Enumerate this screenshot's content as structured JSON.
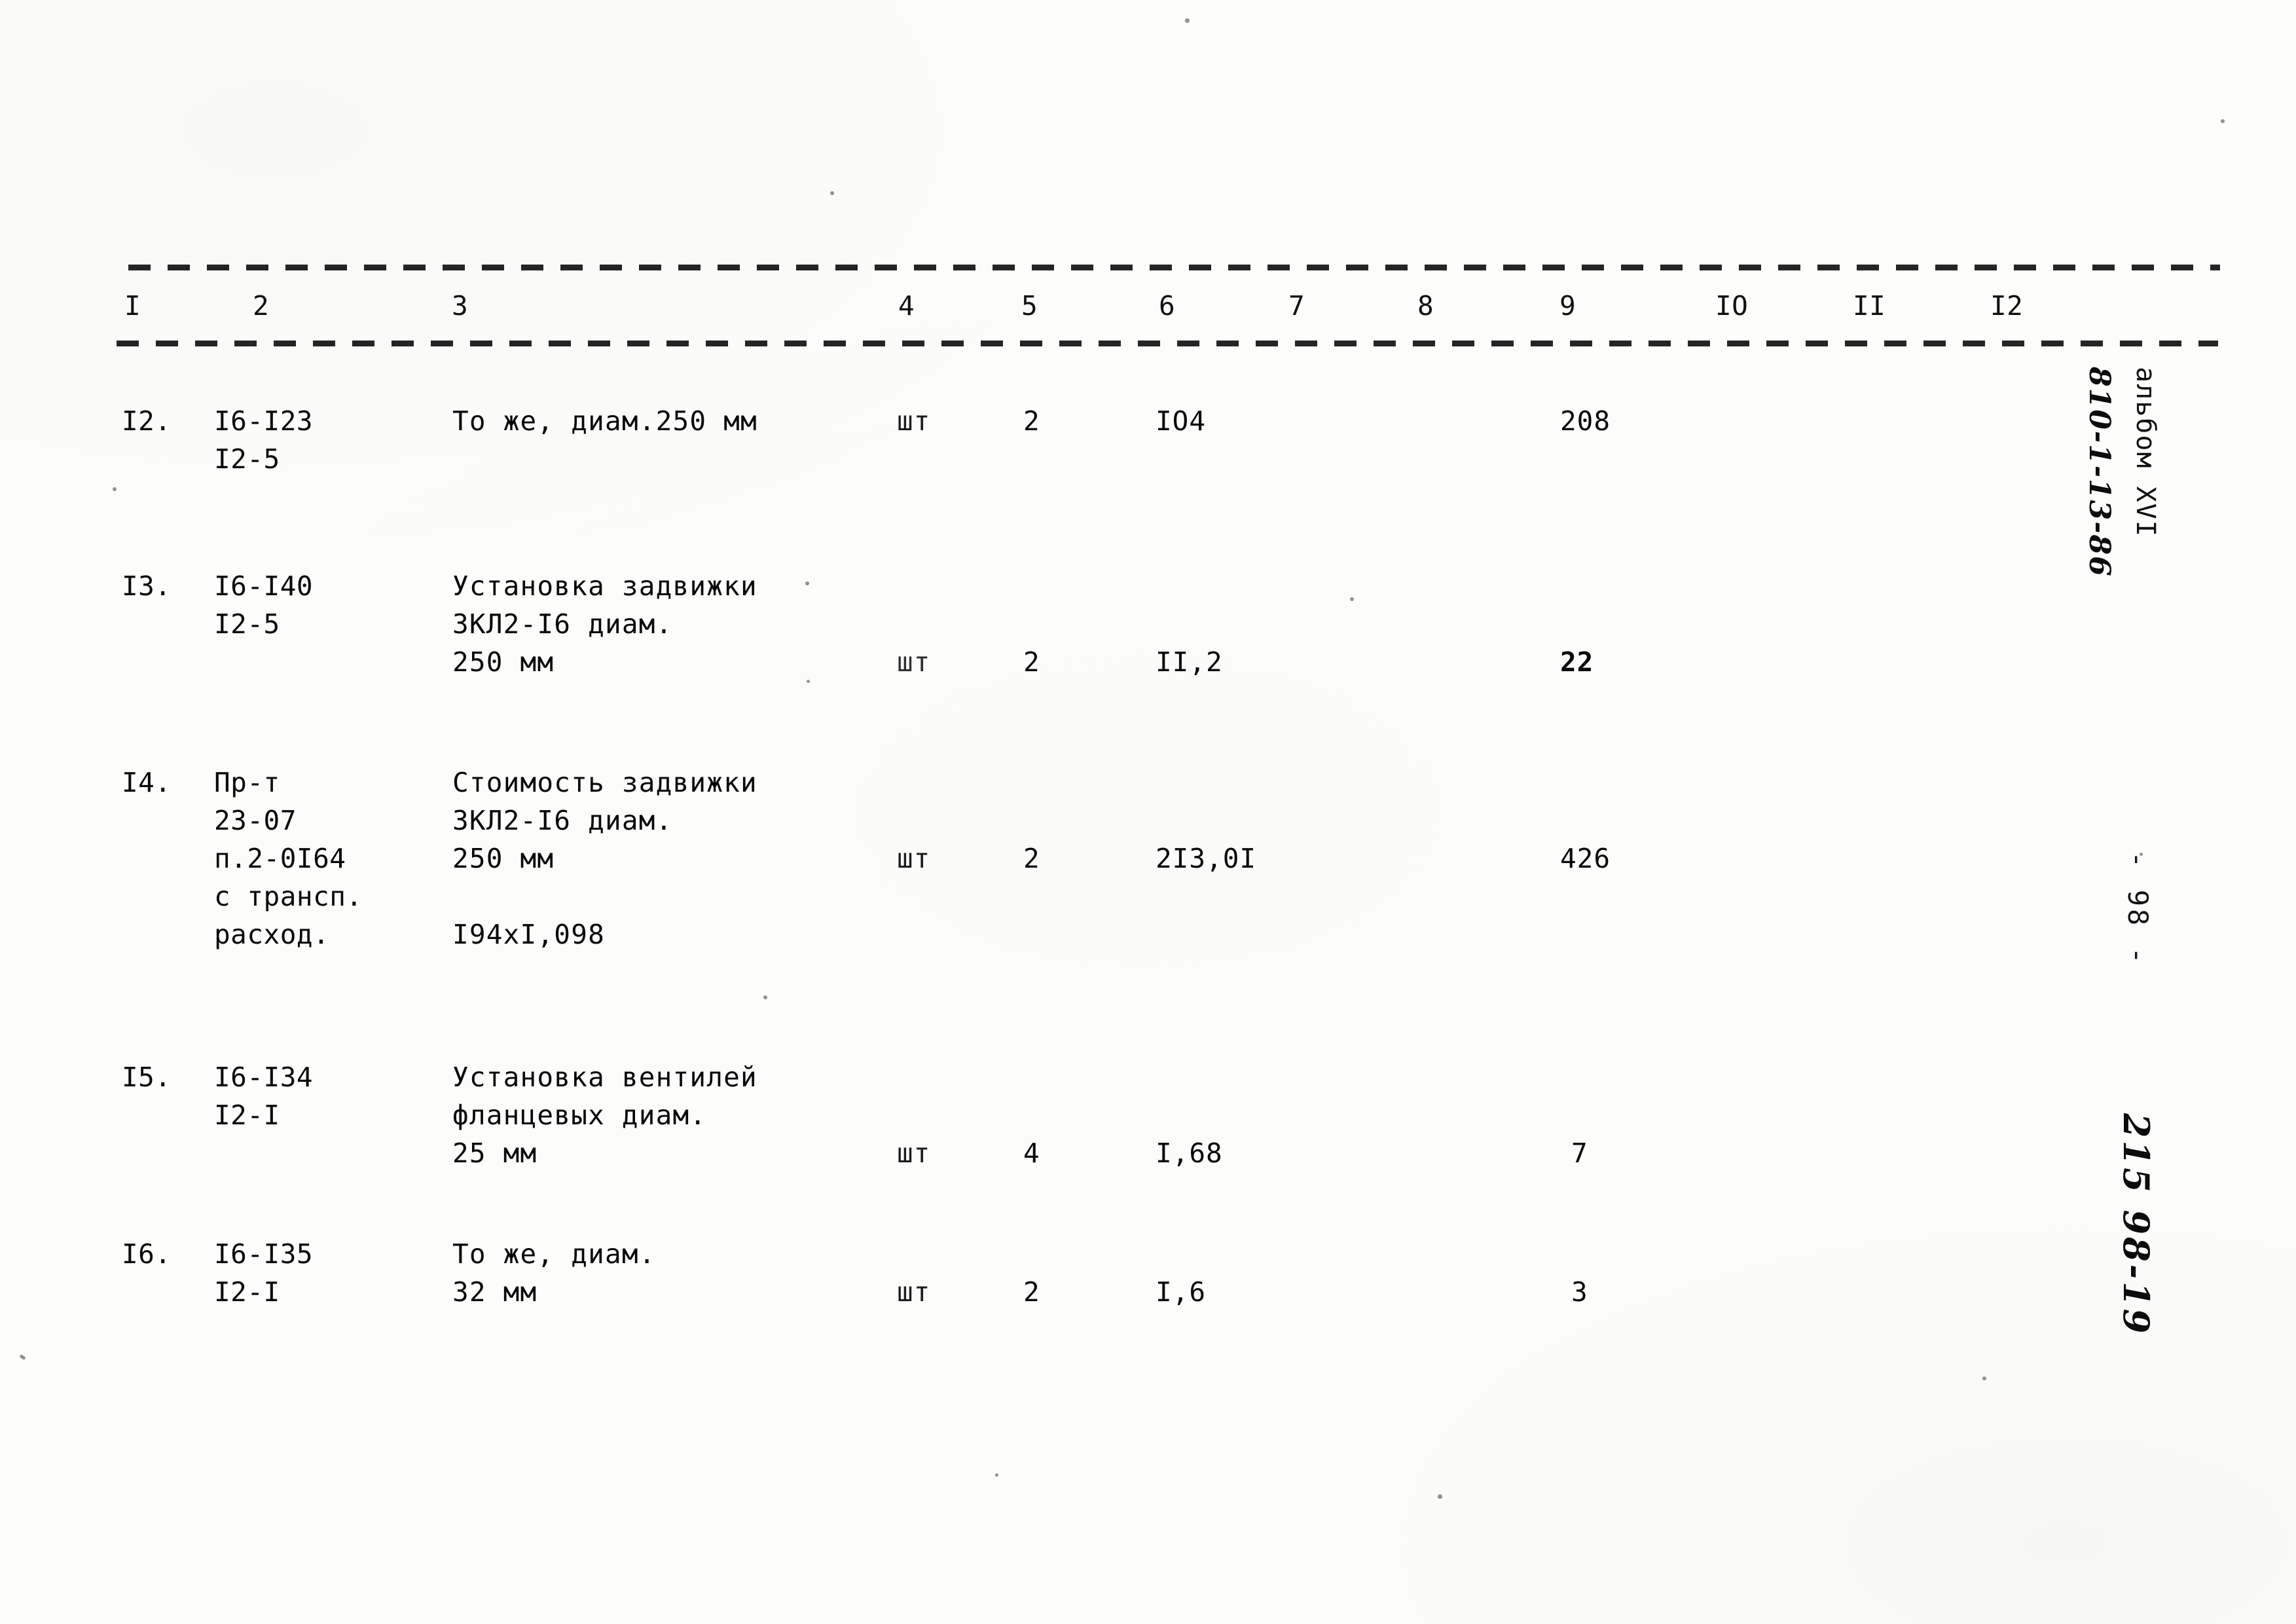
{
  "document": {
    "type": "scanned-estimate-table",
    "language": "ru",
    "page_number": "- 98 -",
    "margin_notes": {
      "album_label": "альбом XVI",
      "album_code": "810-1-13-86",
      "archive_stamp": "215 98-19"
    }
  },
  "table": {
    "column_headers": [
      "I",
      "2",
      "3",
      "4",
      "5",
      "6",
      "7",
      "8",
      "9",
      "IO",
      "II",
      "I2"
    ],
    "rows": [
      {
        "no": "I2.",
        "code_lines": [
          "I6-I23",
          "I2-5"
        ],
        "description_lines": [
          "То же, диам.250 мм"
        ],
        "unit": "шт",
        "qty": "2",
        "price": "IO4",
        "col7": "",
        "col8": "",
        "total": "208",
        "col10": "",
        "col11": "",
        "col12": ""
      },
      {
        "no": "I3.",
        "code_lines": [
          "I6-I40",
          "I2-5"
        ],
        "description_lines": [
          "Установка задвижки",
          "ЗКЛ2-I6 диам.",
          "250 мм"
        ],
        "unit": "шт",
        "qty": "2",
        "price": "II,2",
        "col7": "",
        "col8": "",
        "total": "22",
        "col10": "",
        "col11": "",
        "col12": ""
      },
      {
        "no": "I4.",
        "code_lines": [
          "Пр-т",
          "23-07",
          "п.2-0I64",
          "с трансп.",
          "расход."
        ],
        "description_lines": [
          "Стоимость задвижки",
          "ЗКЛ2-I6 диам.",
          "250 мм"
        ],
        "description_extra": "I94xI,098",
        "unit": "шт",
        "qty": "2",
        "price": "2I3,0I",
        "col7": "",
        "col8": "",
        "total": "426",
        "col10": "",
        "col11": "",
        "col12": ""
      },
      {
        "no": "I5.",
        "code_lines": [
          "I6-I34",
          "I2-I"
        ],
        "description_lines": [
          "Установка вентилей",
          "фланцевых диам.",
          "25 мм"
        ],
        "unit": "шт",
        "qty": "4",
        "price": "I,68",
        "col7": "",
        "col8": "",
        "total": "7",
        "col10": "",
        "col11": "",
        "col12": ""
      },
      {
        "no": "I6.",
        "code_lines": [
          "I6-I35",
          "I2-I"
        ],
        "description_lines": [
          "То же, диам.",
          "32 мм"
        ],
        "unit": "шт",
        "qty": "2",
        "price": "I,6",
        "col7": "",
        "col8": "",
        "total": "3",
        "col10": "",
        "col11": "",
        "col12": ""
      }
    ]
  },
  "colors": {
    "paper": "#fdfdfb",
    "ink": "#111111"
  }
}
